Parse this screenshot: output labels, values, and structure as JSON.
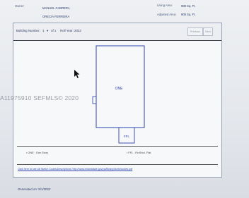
{
  "owner": {
    "label": "Owner:",
    "names": [
      "MANUEL CABRERA",
      "ORECIA FERREIRA"
    ]
  },
  "areas": [
    {
      "label": "Living Area:",
      "value": "988 Sq. Ft."
    },
    {
      "label": "Adjusted Area:",
      "value": "905 Sq. Ft."
    }
  ],
  "sketch": {
    "building_label": "Building Number:",
    "building_value": "1",
    "building_of": "of 1",
    "roll_year": "Roll Year: 2022",
    "prev_label": "Previous",
    "next_label": "Next",
    "main_area_label": "ONE",
    "porch_label": "FFL"
  },
  "legend": [
    {
      "code": "ONE",
      "desc": "One Story"
    },
    {
      "code": "FFL",
      "desc": "Fin/Encl. Flat"
    }
  ],
  "help_link": "Click here to see all Sketch Codes/Descriptions: http://www.miamidade.gov/pa/library/sketchcodes.pdf",
  "watermark": "A11975910 SEFMLS© 2020",
  "generated": "Generated on: 9/1/2022"
}
